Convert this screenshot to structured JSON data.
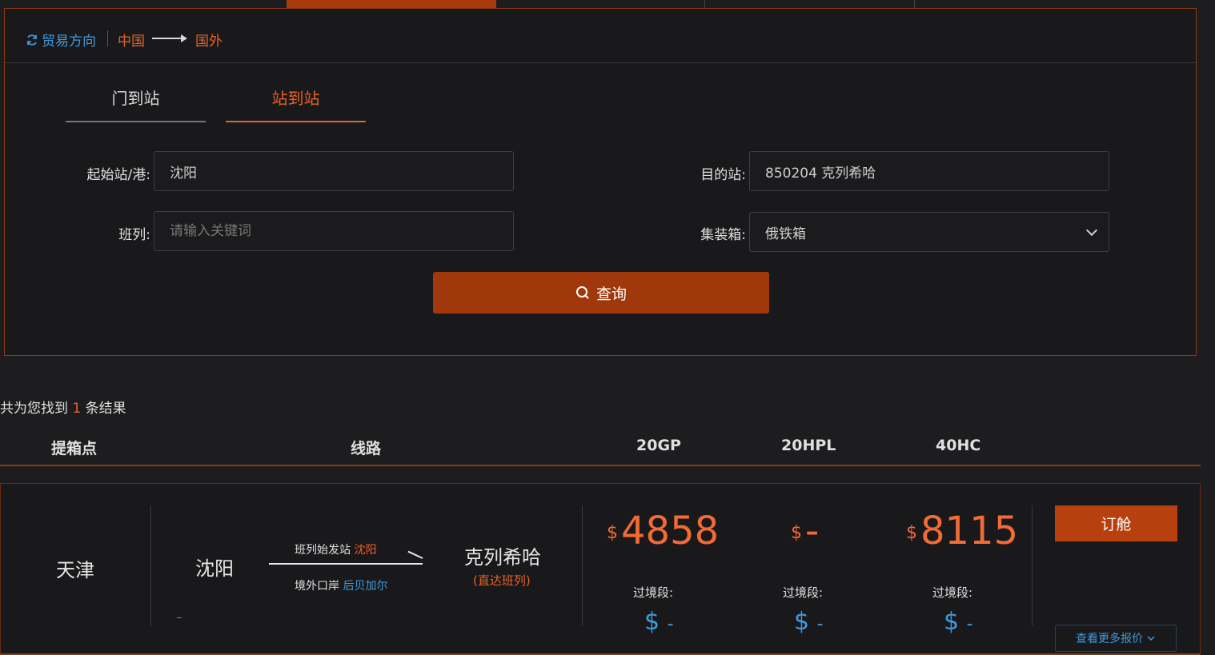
{
  "search": {
    "trade_direction_label": "贸易方向",
    "from": "中国",
    "to": "国外",
    "modes": [
      "门到站",
      "站到站"
    ],
    "active_mode": "站到站",
    "origin_label": "起始站/港:",
    "origin_value": "沈阳",
    "destination_label": "目的站:",
    "destination_value": "850204 克列希哈",
    "train_label": "班列:",
    "train_placeholder": "请输入关键词",
    "container_label": "集装箱:",
    "container_value": "俄铁箱",
    "query_label": "查询"
  },
  "results": {
    "count_prefix": "共为您找到",
    "count": "1",
    "count_suffix": "条结果",
    "headers": {
      "pickup": "提箱点",
      "route": "线路",
      "gp20": "20GP",
      "hpl20": "20HPL",
      "hc40": "40HC"
    },
    "rows": [
      {
        "pickup": "天津",
        "origin": "沈阳",
        "route_top_label": "班列始发站",
        "route_top_value": "沈阳",
        "route_bottom_label": "境外口岸",
        "route_bottom_value": "后贝加尔",
        "destination": "克列希哈",
        "destination_note": "(直达班列)",
        "currency": "$",
        "price_20gp": "4858",
        "price_20hpl": "-",
        "price_40hc": "8115",
        "transit_label": "过境段:",
        "transit_20gp": "-",
        "transit_20hpl": "-",
        "transit_40hc": "-",
        "book_label": "订舱",
        "more_label": "查看更多报价"
      }
    ]
  },
  "colors": {
    "accent": "#e5622a",
    "button": "#a0380c",
    "link": "#3d9be0",
    "background": "#1d1d1f"
  }
}
